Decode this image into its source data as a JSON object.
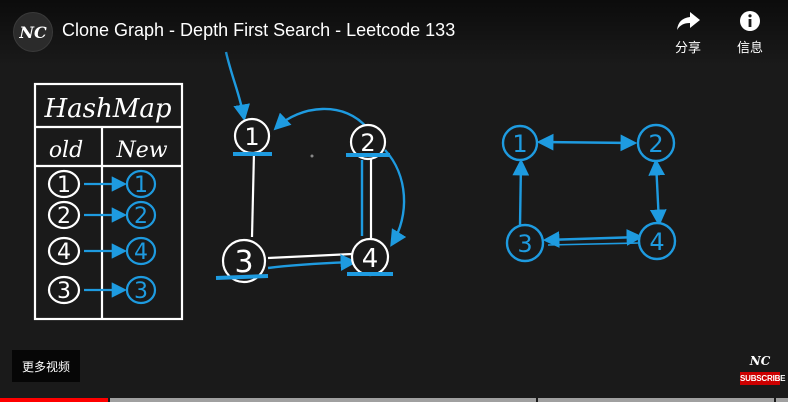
{
  "header": {
    "channel_logo": "NC",
    "title": "Clone Graph - Depth First Search - Leetcode 133",
    "share_label": "分享",
    "share_icon": "share-arrow-icon",
    "info_label": "信息",
    "info_icon": "info-circle-icon"
  },
  "whiteboard": {
    "hashmap": {
      "title": "HashMap",
      "headers": [
        "old",
        "New"
      ],
      "rows": [
        {
          "old": "1",
          "new": "1"
        },
        {
          "old": "2",
          "new": "2"
        },
        {
          "old": "4",
          "new": "4"
        },
        {
          "old": "3",
          "new": "3"
        }
      ]
    },
    "original_graph": {
      "nodes": [
        "1",
        "2",
        "3",
        "4"
      ]
    },
    "cloned_graph": {
      "nodes": [
        "1",
        "2",
        "3",
        "4"
      ]
    },
    "colors": {
      "ink": "#ffffff",
      "accent": "#1e9be0",
      "background": "#1a1a1a"
    }
  },
  "overlay": {
    "more_videos_label": "更多视频",
    "watermark_logo": "NC",
    "watermark_subscribe": "SUBSCRIBE"
  },
  "progress": {
    "played_fraction": 0.14
  }
}
